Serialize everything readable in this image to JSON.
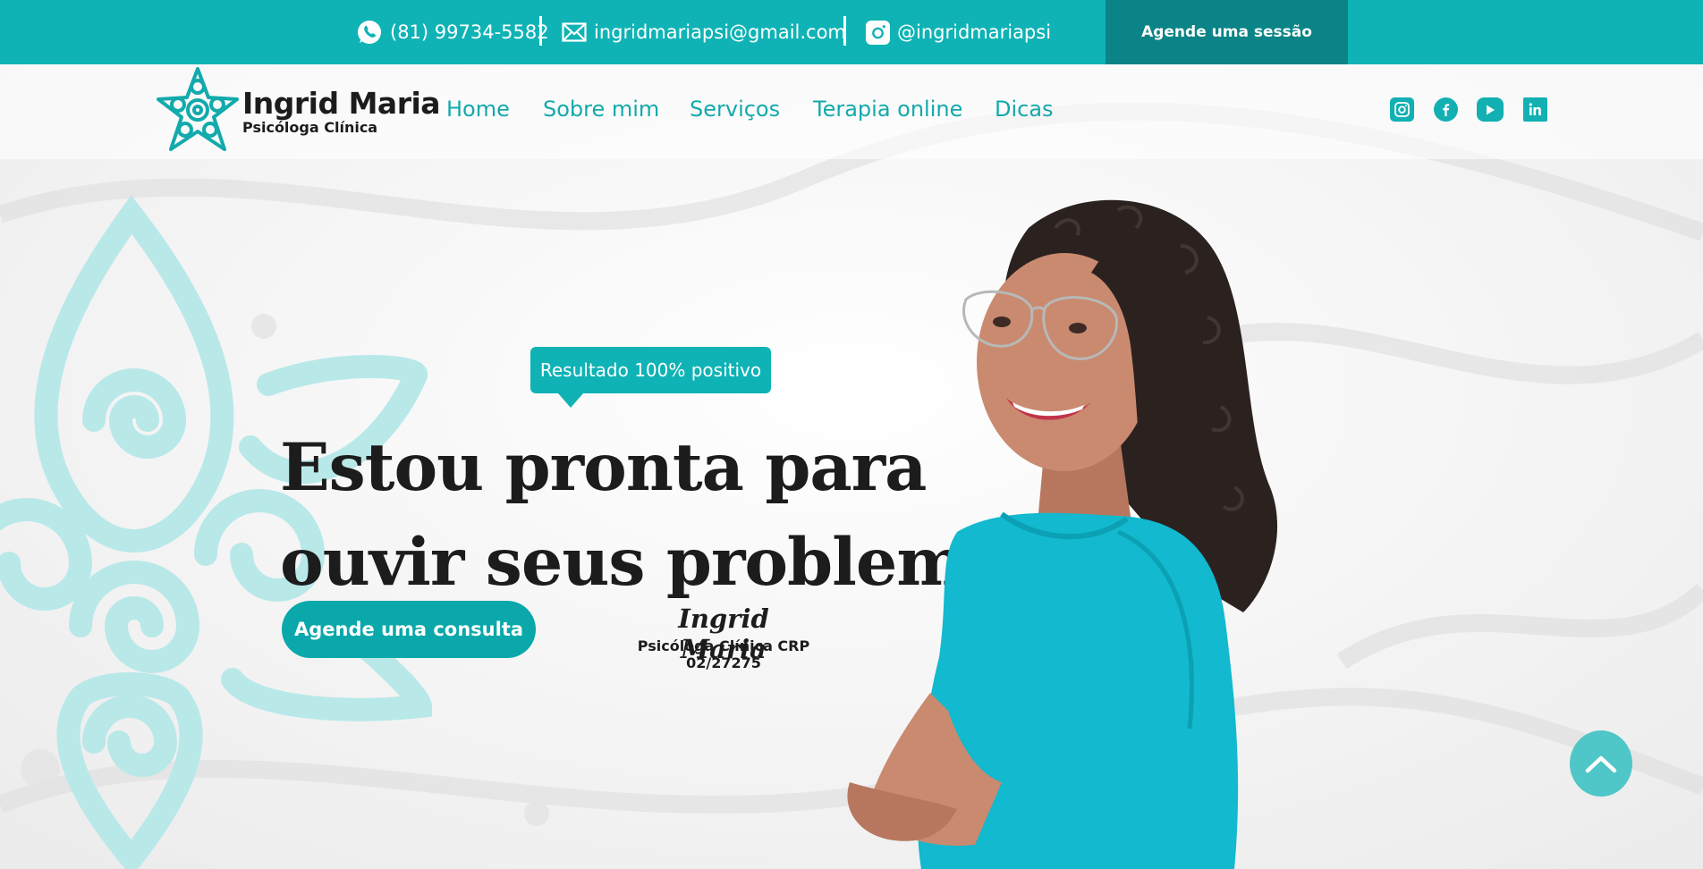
{
  "topbar": {
    "phone": "(81) 99734-5582",
    "email": "ingridmariapsi@gmail.com",
    "instagram": "@ingridmariapsi",
    "cta_label": "Agende uma sessão"
  },
  "brand": {
    "name": "Ingrid Maria",
    "subtitle": "Psicóloga Clínica"
  },
  "nav": {
    "items": [
      {
        "label": "Home"
      },
      {
        "label": "Sobre mim"
      },
      {
        "label": "Serviços"
      },
      {
        "label": "Terapia online"
      },
      {
        "label": "Dicas"
      }
    ]
  },
  "social": {
    "icons": [
      "instagram-icon",
      "facebook-icon",
      "youtube-icon",
      "linkedin-icon"
    ]
  },
  "hero": {
    "badge": "Resultado 100% positivo",
    "headline_line1": "Estou pronta para",
    "headline_line2": "ouvir seus problemas",
    "cta_label": "Agende uma consulta",
    "signature_name": "Ingrid Maria",
    "signature_sub": "Psicóloga Clínica CRP 02/27275"
  },
  "colors": {
    "primary": "#0fb3b5",
    "primary_dark": "#0a8486",
    "text_dark": "#1c1c1c",
    "scroll_button": "#4fc6c7"
  }
}
